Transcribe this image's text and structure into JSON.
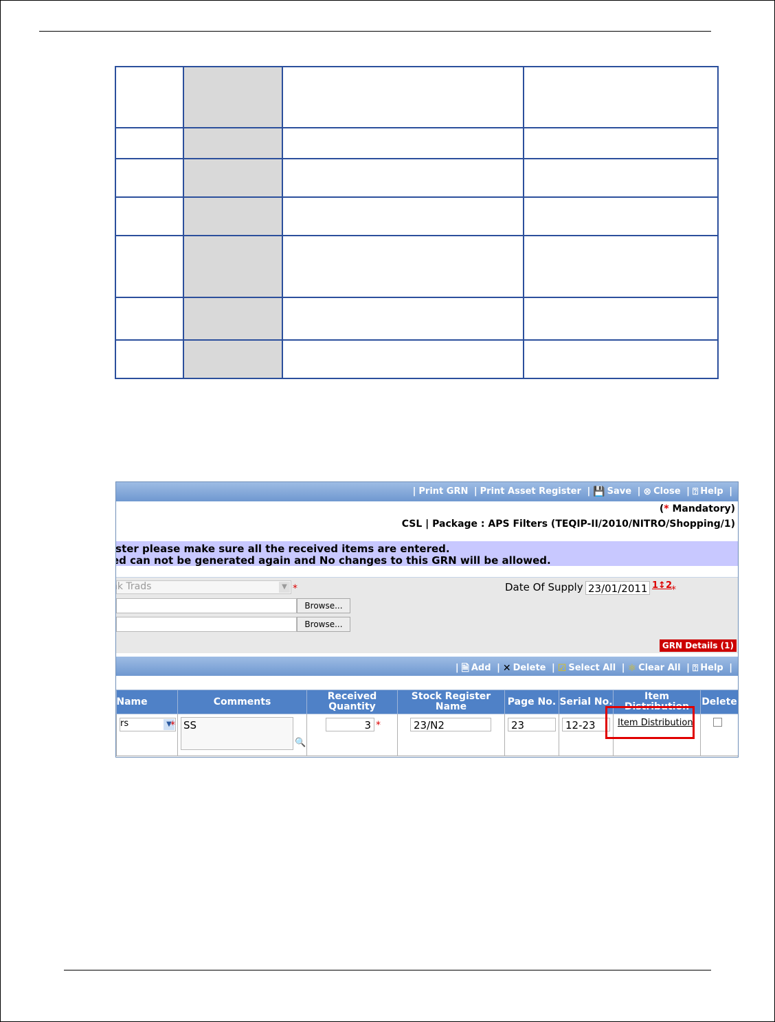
{
  "toolbar": {
    "print_grn": "Print GRN",
    "print_asset_register": "Print Asset Register",
    "save": "Save",
    "close": "Close",
    "help": "Help"
  },
  "mandatory": {
    "paren_open": "(",
    "star": "*",
    "label": "Mandatory)"
  },
  "package_line": "CSL | Package : APS Filters (TEQIP-II/2010/NITRO/Shopping/1)",
  "notice": {
    "line1": "ister please make sure all the received items are entered.",
    "line2": "ed can not be generated again and No changes to this GRN will be allowed."
  },
  "form": {
    "supplier_value": "nk Trads",
    "browse_label": "Browse...",
    "date_of_supply_label": "Date Of Supply",
    "date_of_supply_value": "23/01/2011",
    "calendar_glyph": "1↕2",
    "star": "*"
  },
  "grn_badge": "GRN Details (1)",
  "grid_toolbar": {
    "add": "Add",
    "delete": "Delete",
    "select_all": "Select All",
    "clear_all": "Clear All",
    "help": "Help"
  },
  "grid": {
    "headers": {
      "name": "Name",
      "comments": "Comments",
      "received_qty": "Received Quantity",
      "stock_register": "Stock Register Name",
      "page_no": "Page No.",
      "serial_no": "Serial No.",
      "item_distribution": "Item Distribution",
      "delete": "Delete"
    },
    "row": {
      "name_value": "rs",
      "comments": "SS",
      "received_qty": "3",
      "stock_register": "23/N2",
      "page_no": "23",
      "serial_no": "12-23",
      "item_distribution_link": "Item Distribution"
    }
  },
  "icons": {
    "save": "floppy-disk-icon",
    "close": "close-circle-icon",
    "help": "help-icon",
    "add": "new-document-icon",
    "delete": "x-icon",
    "select_all": "clipboard-check-icon",
    "clear_all": "broom-icon",
    "zoom": "magnifier-icon"
  },
  "colors": {
    "toolbar": "#6f98d0",
    "grid_header": "#4f81c7",
    "notice_bg": "#c8c8ff",
    "badge": "#cc0000",
    "highlight": "#e00000",
    "table_border": "#2b4f9c",
    "shaded_cell": "#d9d9d9"
  }
}
